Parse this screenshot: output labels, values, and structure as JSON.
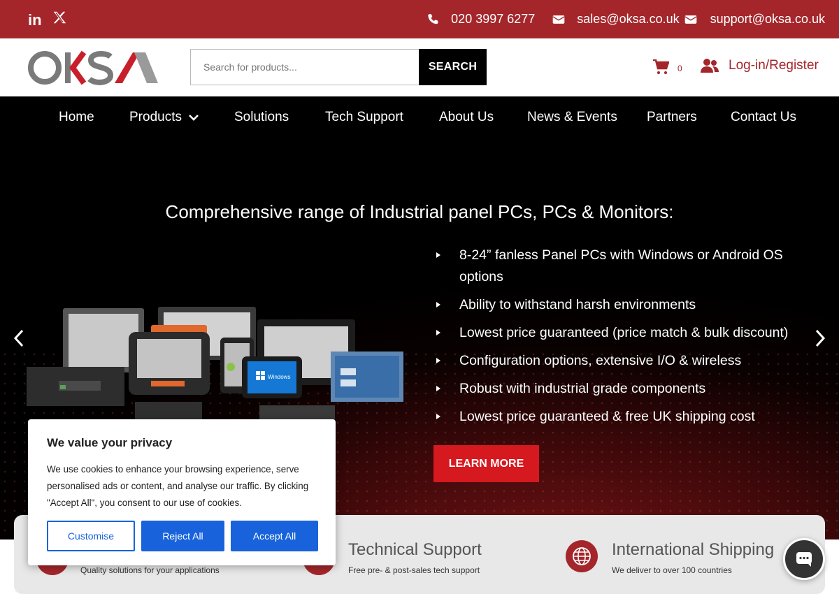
{
  "topbar": {
    "social": [
      {
        "icon": "linkedin-icon",
        "label": "in"
      },
      {
        "icon": "x-icon",
        "label": "𝕏"
      }
    ],
    "phone": "020 3997 6277",
    "sales_email": "sales@oksa.co.uk",
    "support_email": "support@oksa.co.uk",
    "color": "#a4262b"
  },
  "header": {
    "search": {
      "placeholder": "Search for products...",
      "button": "SEARCH"
    },
    "cart_count": "0",
    "login_label": "Log-in/Register"
  },
  "nav": {
    "items": [
      "Home",
      "Products",
      "Solutions",
      "Tech Support",
      "About Us",
      "News & Events",
      "Partners",
      "Contact Us"
    ]
  },
  "hero": {
    "title": "Comprehensive range of Industrial panel PCs, PCs & Monitors:",
    "features": [
      "8-24” fanless Panel PCs with Windows or Android OS options",
      "Ability to withstand harsh environments",
      "Lowest price guaranteed (price match & bulk discount)",
      "Configuration options, extensive I/O & wireless",
      "Robust with industrial grade components",
      "Lowest price guaranteed & free UK shipping cost"
    ],
    "cta": "LEARN MORE",
    "device_screen_label": "Windows"
  },
  "strip": {
    "items": [
      {
        "title": "",
        "subtitle": "Quality solutions for your applications"
      },
      {
        "title": "Technical Support",
        "subtitle": "Free pre- & post-sales tech support"
      },
      {
        "title": "International Shipping",
        "subtitle": "We deliver to over 100 countries"
      }
    ]
  },
  "cookie": {
    "title": "We value your privacy",
    "body": "We use cookies to enhance your browsing experience, serve personalised ads or content, and analyse our traffic. By clicking \"Accept All\", you consent to our use of cookies.",
    "customise": "Customise",
    "reject": "Reject All",
    "accept": "Accept All"
  },
  "colors": {
    "brand": "#a4262b",
    "cta": "#d6181f",
    "cookie_blue": "#1863dc"
  }
}
